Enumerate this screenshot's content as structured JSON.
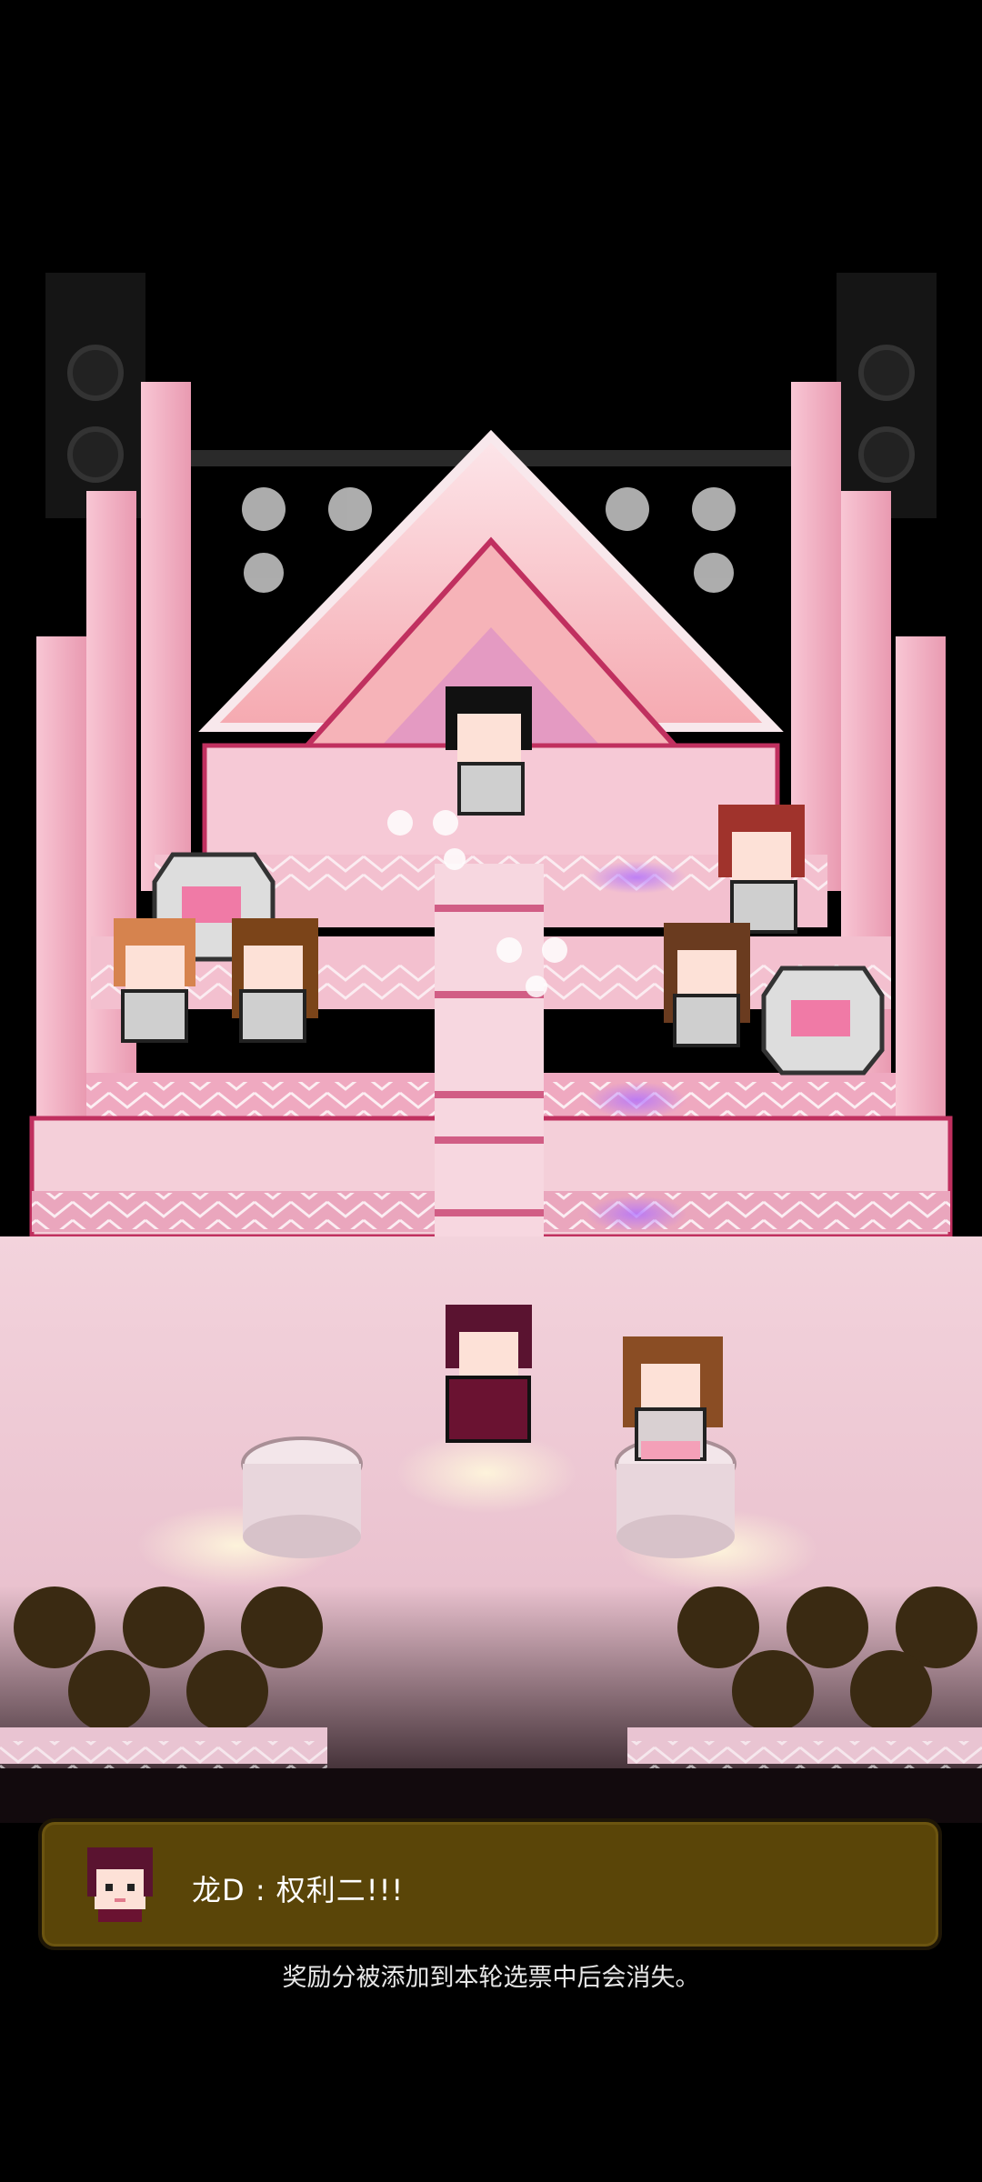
{
  "dialog": {
    "speaker_avatar_icon": "idol-avatar-icon",
    "text": "龙D : 权利二!!!"
  },
  "hint": "奖励分被添加到本轮选票中后会消失。",
  "colors": {
    "stage_pink": "#f6c9d6",
    "stage_trim": "#c0305f",
    "dialog_bg": "#5a4508",
    "background": "#000000"
  }
}
